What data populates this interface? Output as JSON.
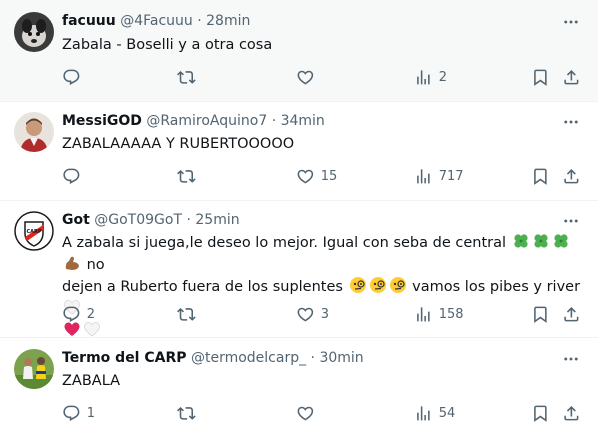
{
  "tweets": [
    {
      "name": "facuuu",
      "handle": "@4Facuuu",
      "separator": "·",
      "time": "28min",
      "text": "Zabala - Boselli y a otra cosa",
      "replies": "",
      "retweets": "",
      "likes": "",
      "views": "2",
      "selected": true
    },
    {
      "name": "MessiGOD",
      "handle": "@RamiroAquino7",
      "separator": "·",
      "time": "34min",
      "text": "ZABALAAAAA Y RUBERTOOOOO",
      "replies": "",
      "retweets": "",
      "likes": "15",
      "views": "717"
    },
    {
      "name": "Got",
      "handle": "@GoT09GoT",
      "separator": "·",
      "time": "25min",
      "text_line1_a": "A zabala si juega,le deseo lo mejor. Igual con seba de central",
      "text_line1_b": "no",
      "text_line2_a": "dejen a Ruberto fuera de los suplentes",
      "text_line2_b": "vamos los pibes y river",
      "replies": "2",
      "retweets": "",
      "likes": "3",
      "views": "158"
    },
    {
      "name": "Termo del CARP",
      "handle": "@termodelcarp_",
      "separator": "·",
      "time": "30min",
      "text": "ZABALA",
      "replies": "1",
      "retweets": "",
      "likes": "",
      "views": "54"
    }
  ],
  "icons": {
    "reply": "reply-icon",
    "retweet": "retweet-icon",
    "like": "like-icon",
    "views": "views-icon",
    "bookmark": "bookmark-icon",
    "share": "share-icon",
    "more": "more-icon"
  },
  "colors": {
    "text": "#0f1419",
    "secondary": "#536471",
    "separator": "#eff3f4",
    "selected_bg": "#f7f9f9"
  }
}
